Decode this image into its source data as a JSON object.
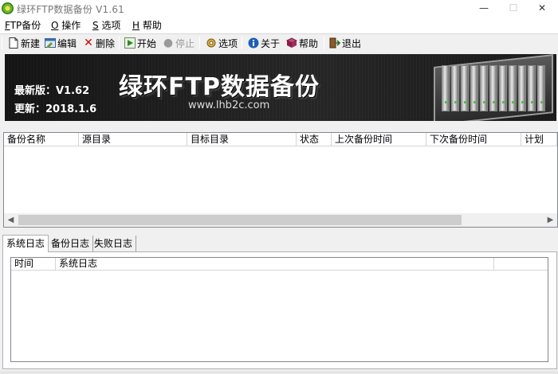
{
  "window": {
    "title": "绿环FTP数据备份 V1.61",
    "controls": {
      "minimize": "—",
      "maximize": "☐",
      "close": "✕"
    }
  },
  "menu": [
    {
      "accel": "F",
      "rest": "TP备份"
    },
    {
      "accel": "O",
      "rest": " 操作"
    },
    {
      "accel": "S",
      "rest": " 选项"
    },
    {
      "accel": "H",
      "rest": " 帮助"
    }
  ],
  "toolbar": {
    "new": "新建",
    "edit": "编辑",
    "delete": "删除",
    "start": "开始",
    "stop": "停止",
    "options": "选项",
    "about": "关于",
    "help": "帮助",
    "exit": "退出"
  },
  "banner": {
    "version": "最新版：V1.62",
    "updated": "更新：2018.1.6",
    "title": "绿环FTP数据备份",
    "url": "www.lhb2c.com"
  },
  "task_list": {
    "columns": [
      "备份名称",
      "源目录",
      "目标目录",
      "状态",
      "上次备份时间",
      "下次备份时间",
      "计划"
    ],
    "rows": []
  },
  "log_tabs": [
    {
      "label": "系统日志",
      "active": true
    },
    {
      "label": "备份日志",
      "active": false
    },
    {
      "label": "失败日志",
      "active": false
    }
  ],
  "log_list": {
    "columns": [
      "时间",
      "系统日志"
    ],
    "rows": []
  },
  "colors": {
    "title_text": "#777777",
    "delete_icon": "#cc0000",
    "start_icon": "#2b8a2b",
    "about_icon": "#1e5fb4",
    "help_icon": "#8b1a4a"
  }
}
